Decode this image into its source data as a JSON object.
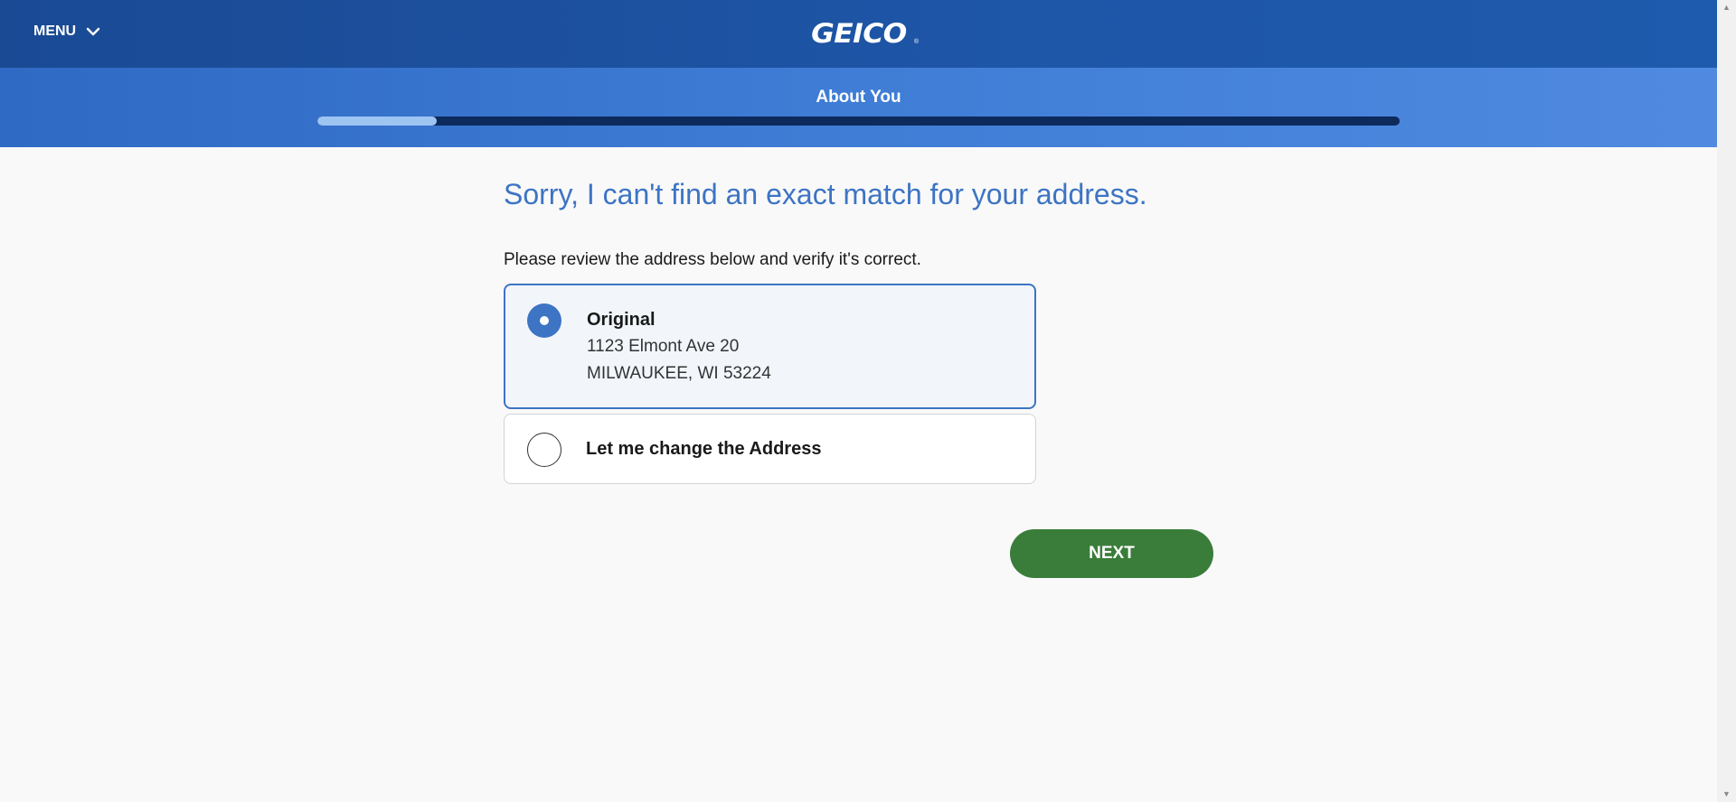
{
  "header": {
    "menu_label": "MENU",
    "menu_icon": "chevron-down-icon",
    "logo_text": "GEICO",
    "logo_mark": "®",
    "colors": {
      "header_bg": "#1e56a8",
      "band_bg": "#3f7dd6"
    }
  },
  "progress": {
    "section_title": "About You",
    "fraction_complete": 0.11,
    "fill_color": "#9ec4f2",
    "track_color": "#0d2a5c"
  },
  "main": {
    "heading": "Sorry, I can't find an exact match for your address.",
    "instructions": "Please review the address below and verify it's correct.",
    "options": [
      {
        "title": "Original",
        "address_line1": "1123 Elmont Ave 20",
        "address_line2": "MILWAUKEE, WI 53224",
        "selected": true
      },
      {
        "title": "Let me change the Address",
        "selected": false
      }
    ],
    "next_label": "NEXT",
    "accent_color": "#3d74c3",
    "next_color": "#3a7d3a"
  },
  "scrollbar": {
    "up_icon": "scroll-up-arrow-icon",
    "down_icon": "scroll-down-arrow-icon"
  }
}
